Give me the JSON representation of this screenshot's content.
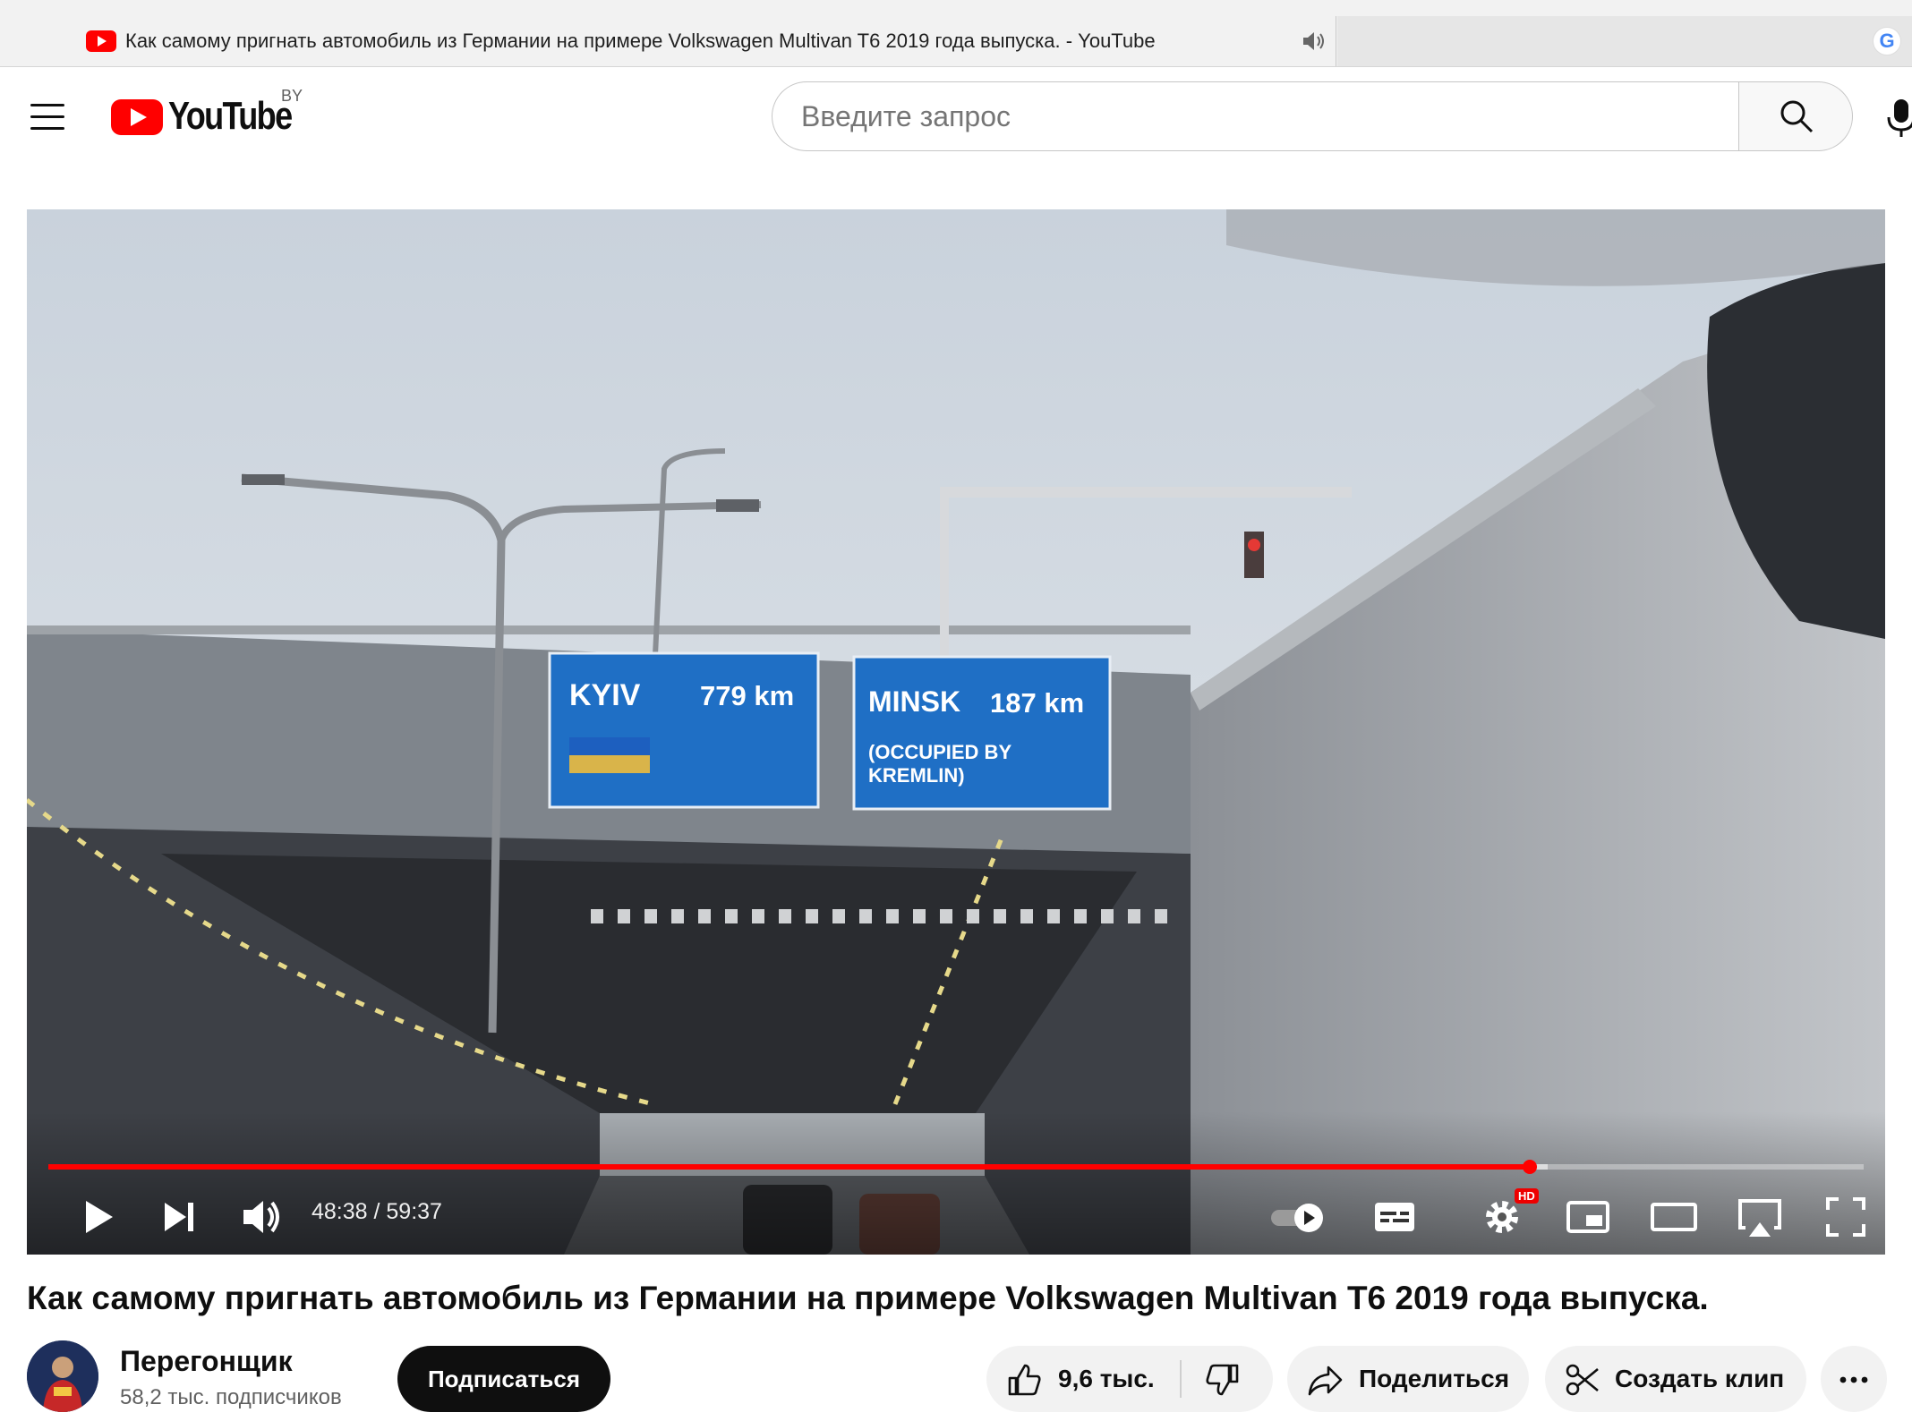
{
  "browser": {
    "tab_title": "Как самому пригнать автомобиль из Германии на примере Volkswagen Multivan T6 2019 года выпуска. - YouTube"
  },
  "masthead": {
    "logo_text": "YouTube",
    "region": "BY",
    "search_placeholder": "Введите запрос"
  },
  "player": {
    "current_time": "48:38",
    "duration": "59:37",
    "time_display": "48:38 / 59:37",
    "progress_fraction": 0.816,
    "buffered_fraction": 0.826,
    "progress_color": "#ff0000",
    "hd_badge": "HD",
    "scene": {
      "sign_left_city": "KYIV",
      "sign_left_distance": "779 km",
      "sign_right_city": "MINSK",
      "sign_right_distance": "187 km",
      "sign_right_note_line1": "(OCCUPIED BY",
      "sign_right_note_line2": "KREMLIN)"
    },
    "controls": [
      "play-icon",
      "next-icon",
      "volume-icon",
      "autoplay-toggle",
      "subtitles-icon",
      "settings-icon",
      "miniplayer-icon",
      "theater-icon",
      "airplay-icon",
      "fullscreen-icon"
    ]
  },
  "video": {
    "title": "Как самому пригнать автомобиль из Германии на примере Volkswagen Multivan T6 2019 года выпуска.",
    "channel_name": "Перегонщик",
    "subscribers": "58,2 тыс. подписчиков",
    "subscribe_label": "Подписаться",
    "likes": "9,6 тыс.",
    "share_label": "Поделиться",
    "clip_label": "Создать клип"
  }
}
